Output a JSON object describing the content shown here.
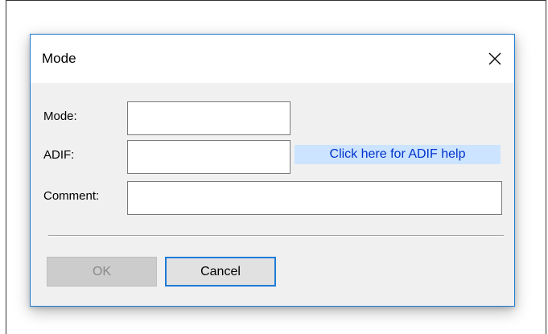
{
  "dialog": {
    "title": "Mode",
    "close_icon": "close-icon",
    "fields": {
      "mode": {
        "label": "Mode:",
        "value": ""
      },
      "adif": {
        "label": "ADIF:",
        "value": ""
      },
      "comment": {
        "label": "Comment:",
        "value": ""
      }
    },
    "help_link": "Click here for ADIF help",
    "buttons": {
      "ok": {
        "label": "OK",
        "enabled": false
      },
      "cancel": {
        "label": "Cancel",
        "focused": true
      }
    }
  },
  "colors": {
    "accent": "#1e7bd6",
    "link_text": "#0033cc",
    "link_background": "#cce4ff",
    "dialog_background": "#f0f0f0"
  }
}
